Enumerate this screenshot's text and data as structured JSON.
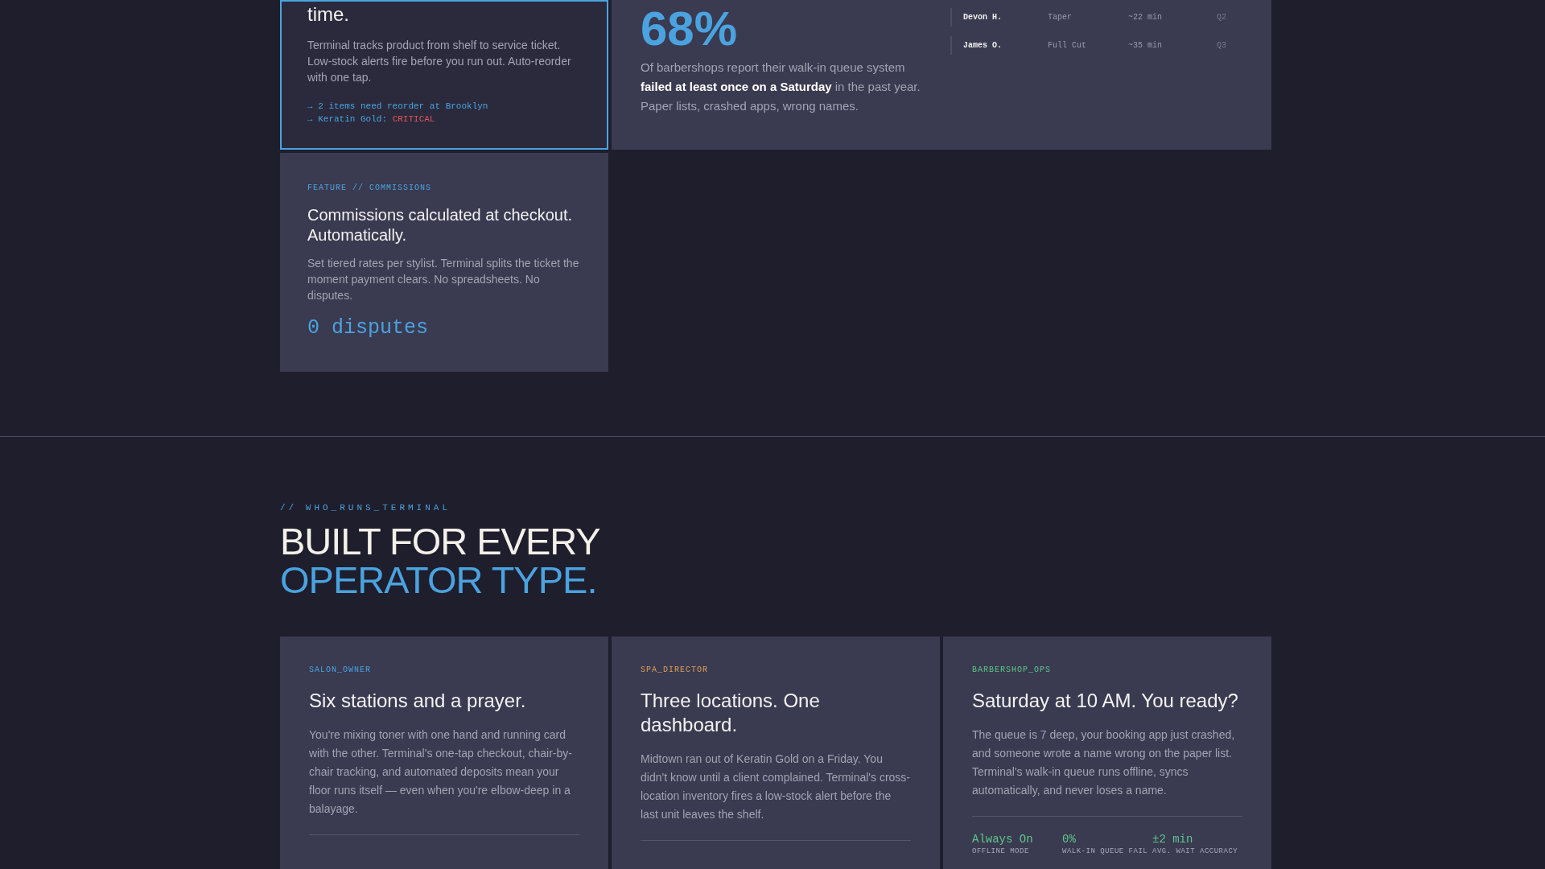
{
  "features": {
    "inventory": {
      "title": "time.",
      "body": "Terminal tracks product from shelf to service ticket. Low-stock alerts fire before you run out. Auto-reorder with one tap.",
      "selected": true,
      "alerts": [
        {
          "text": "→ 2 items need reorder at Brooklyn"
        },
        {
          "text": "→ Keratin Gold: ",
          "critical": "CRITICAL"
        }
      ]
    },
    "stat": {
      "value": "68%",
      "body": "Of barbershops report their walk-in queue system **failed at least once on a Saturday** in the past year. Paper lists, crashed apps, wrong names.",
      "queue": [
        {
          "name": "Devon H.",
          "service": "Taper",
          "wait": "~22 min",
          "position": "Q2"
        },
        {
          "name": "James O.",
          "service": "Full Cut",
          "wait": "~35 min",
          "position": "Q3"
        }
      ]
    },
    "commissions": {
      "label": "FEATURE // COMMISSIONS",
      "title": "Commissions calculated at checkout. Automatically.",
      "body": "Set tiered rates per stylist. Terminal splits the ticket the moment payment clears. No spreadsheets. No disputes.",
      "metric": "0 disputes"
    }
  },
  "operators": {
    "eyebrow": "// WHO_RUNS_TERMINAL",
    "heading_line_1": "BUILT FOR EVERY",
    "heading_line_2": "OPERATOR TYPE.",
    "cards": [
      {
        "label": "SALON_OWNER",
        "color": "#4aa3df",
        "title": "Six stations and a prayer.",
        "body": "You're mixing toner with one hand and running card with the other. Terminal's one-tap checkout, chair-by-chair tracking, and automated deposits mean your floor runs itself — even when you're elbow-deep in a balayage."
      },
      {
        "label": "SPA_DIRECTOR",
        "color": "#d9a05b",
        "title": "Three locations. One dashboard.",
        "body": "Midtown ran out of Keratin Gold on a Friday. You didn't know until a client complained. Terminal's cross-location inventory fires a low-stock alert before the last unit leaves the shelf."
      },
      {
        "label": "BARBERSHOP_OPS",
        "color": "#5cc78a",
        "title": "Saturday at 10 AM. You ready?",
        "body": "The queue is 7 deep, your booking app just crashed, and someone wrote a name wrong on the paper list. Terminal's walk-in queue runs offline, syncs automatically, and never loses a name.",
        "stats": [
          {
            "value": "Always On",
            "label": "OFFLINE MODE"
          },
          {
            "value": "0%",
            "label": "WALK-IN QUEUE FAIL"
          },
          {
            "value": "±2 min",
            "label": "AVG. WAIT ACCURACY"
          }
        ]
      }
    ]
  }
}
